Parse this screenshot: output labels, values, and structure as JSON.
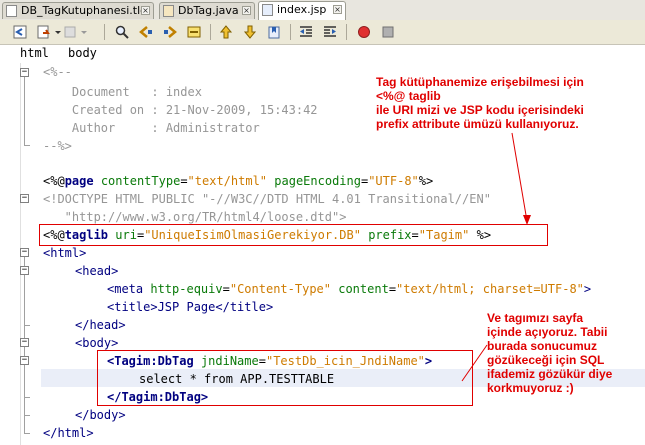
{
  "tabs": [
    {
      "label": "DB_TagKutuphanesi.tld",
      "active": false
    },
    {
      "label": "DbTag.java",
      "active": false
    },
    {
      "label": "index.jsp",
      "active": true
    }
  ],
  "breadcrumbs": [
    "html",
    "body"
  ],
  "code": {
    "l1": "<%--",
    "l2": "    Document   : index",
    "l3": "    Created on : 21-Nov-2009, 15:43:42",
    "l4": "    Author     : Administrator",
    "l5": "--%>",
    "page_open": "<%@",
    "page_kw": "page",
    "page_a1": "contentType",
    "page_v1": "\"text/html\"",
    "page_a2": "pageEncoding",
    "page_v2": "\"UTF-8\"",
    "page_close": "%>",
    "doctype1": "<!DOCTYPE HTML PUBLIC \"-//W3C//DTD HTML 4.01 Transitional//EN\"",
    "doctype2": "   \"http://www.w3.org/TR/html4/loose.dtd\">",
    "tl_open": "<%@",
    "tl_kw": "taglib",
    "tl_a1": "uri",
    "tl_v1": "\"UniqueIsimOlmasiGerekiyor.DB\"",
    "tl_a2": "prefix",
    "tl_v2": "\"Tagim\"",
    "tl_close": "%>",
    "html_open": "<html>",
    "head_open": "<head>",
    "meta_open": "<meta",
    "meta_a1": "http-equiv",
    "meta_v1": "\"Content-Type\"",
    "meta_a2": "content",
    "meta_v2": "\"text/html; charset=UTF-8\"",
    "meta_close": ">",
    "title_line": "<title>JSP Page</title>",
    "head_close": "</head>",
    "body_open": "<body>",
    "dbtag_open": "<Tagim:DbTag",
    "dbtag_a1": "jndiName",
    "dbtag_v1": "\"TestDb_icin_JndiName\"",
    "dbtag_gt": ">",
    "sql": "select * from APP.TESTTABLE",
    "dbtag_close": "</Tagim:DbTag>",
    "body_close": "</body>",
    "html_close": "</html>"
  },
  "annotations": {
    "top": "Tag kütüphanemize erişebilmesi için\n<%@ taglib\nile URI mizi ve JSP kodu içerisindeki\nprefix attribute ümüzü kullanıyoruz.",
    "bottom": "Ve tagımızı sayfa\niçinde açıyoruz. Tabii\nburada sonucumuz\ngözükeceği için SQL\nifademiz gözükür diye\nkorkmuyoruz :)"
  },
  "colors": {
    "annotation": "#e00000",
    "keyword": "#000080",
    "attribute": "#0a7a0a",
    "string": "#ce7b00",
    "comment": "#969696"
  }
}
